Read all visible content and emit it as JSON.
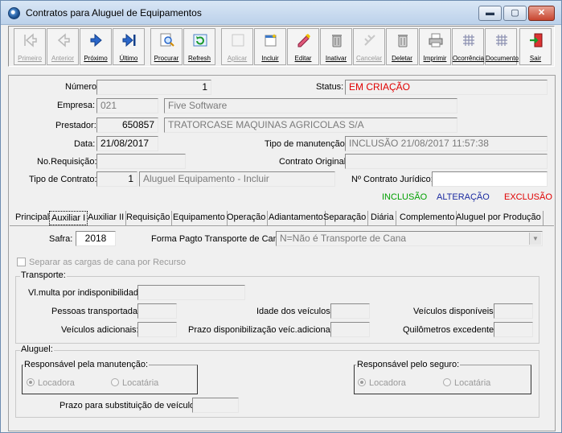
{
  "window": {
    "title": "Contratos para Aluguel de Equipamentos",
    "buttons": {
      "minimize": "▬",
      "maximize": "▢",
      "close": "✕"
    }
  },
  "toolbar": [
    {
      "label": "Primeiro",
      "icon": "first-record-icon",
      "enabled": false
    },
    {
      "label": "Anterior",
      "icon": "previous-record-icon",
      "enabled": false
    },
    {
      "label": "Próximo",
      "icon": "next-record-icon",
      "enabled": true
    },
    {
      "label": "Último",
      "icon": "last-record-icon",
      "enabled": true
    },
    {
      "label": "Procurar",
      "icon": "search-icon",
      "enabled": true
    },
    {
      "label": "Refresh",
      "icon": "refresh-icon",
      "enabled": true
    },
    {
      "label": "Aplicar",
      "icon": "apply-icon",
      "enabled": false
    },
    {
      "label": "Incluir",
      "icon": "new-record-icon",
      "enabled": true
    },
    {
      "label": "Editar",
      "icon": "edit-icon",
      "enabled": true
    },
    {
      "label": "Inativar",
      "icon": "inactivate-icon",
      "enabled": true
    },
    {
      "label": "Cancelar",
      "icon": "cancel-icon",
      "enabled": false
    },
    {
      "label": "Deletar",
      "icon": "delete-icon",
      "enabled": true
    },
    {
      "label": "Imprimir",
      "icon": "print-icon",
      "enabled": true
    },
    {
      "label": "Ocorrência",
      "icon": "occurrence-icon",
      "enabled": true
    },
    {
      "label": "Documento",
      "icon": "document-icon",
      "enabled": true
    },
    {
      "label": "Sair",
      "icon": "exit-icon",
      "enabled": true
    }
  ],
  "form": {
    "numero_label": "Número:",
    "numero": "1",
    "status_label": "Status:",
    "status": "EM CRIAÇÃO",
    "empresa_label": "Empresa:",
    "empresa_code": "021",
    "empresa_name": "Five Software",
    "prestador_label": "Prestador:",
    "prestador_code": "650857",
    "prestador_name": "TRATORCASE MAQUINAS AGRICOLAS S/A",
    "data_label": "Data:",
    "data": "21/08/2017",
    "tipo_manutencao_label": "Tipo de manutenção:",
    "tipo_manutencao": "INCLUSÃO 21/08/2017 11:57:38",
    "requisicao_label": "No.Requisição:",
    "requisicao": "",
    "contrato_original_label": "Contrato Original:",
    "contrato_original": "",
    "tipo_contrato_label": "Tipo de Contrato:",
    "tipo_contrato_code": "1",
    "tipo_contrato_name": "Aluguel Equipamento - Incluir",
    "contrato_juridico_label": "Nº Contrato Jurídico:",
    "contrato_juridico": ""
  },
  "legend": {
    "inclusao": "INCLUSÃO",
    "alteracao": "ALTERAÇÃO",
    "exclusao": "EXCLUSÃO",
    "colors": {
      "inclusao": "#00a000",
      "alteracao": "#1a2aa0",
      "exclusao": "#e00000",
      "status": "#e00000"
    }
  },
  "tabs": [
    "Principal",
    "Auxiliar I",
    "Auxiliar II",
    "Requisição",
    "Equipamento",
    "Operação",
    "Adiantamento",
    "Separação",
    "Diária",
    "Complemento",
    "Aluguel por Produção"
  ],
  "active_tab": "Auxiliar I",
  "auxiliar": {
    "safra_label": "Safra:",
    "safra": "2018",
    "forma_pagto_label": "Forma Pagto Transporte de Cana:",
    "forma_pagto": "N=Não é Transporte de Cana",
    "separar_label": "Separar as cargas de cana por Recurso",
    "transporte_title": "Transporte:",
    "multa_label": "Vl.multa por indisponibilidade:",
    "pessoas_label": "Pessoas transportadas:",
    "idade_label": "Idade dos veículos:",
    "disponiveis_label": "Veículos disponíveis:",
    "adicionais_label": "Veículos adicionais:",
    "prazo_disp_label": "Prazo disponibilização veíc.adicionais:",
    "quilometros_label": "Quilômetros excedentes:",
    "aluguel_title": "Aluguel:",
    "resp_manut_title": "Responsável pela manutenção:",
    "resp_seguro_title": "Responsável pelo seguro:",
    "locadora": "Locadora",
    "locataria": "Locatária",
    "prazo_subst_label": "Prazo para substituição de veículos:"
  }
}
